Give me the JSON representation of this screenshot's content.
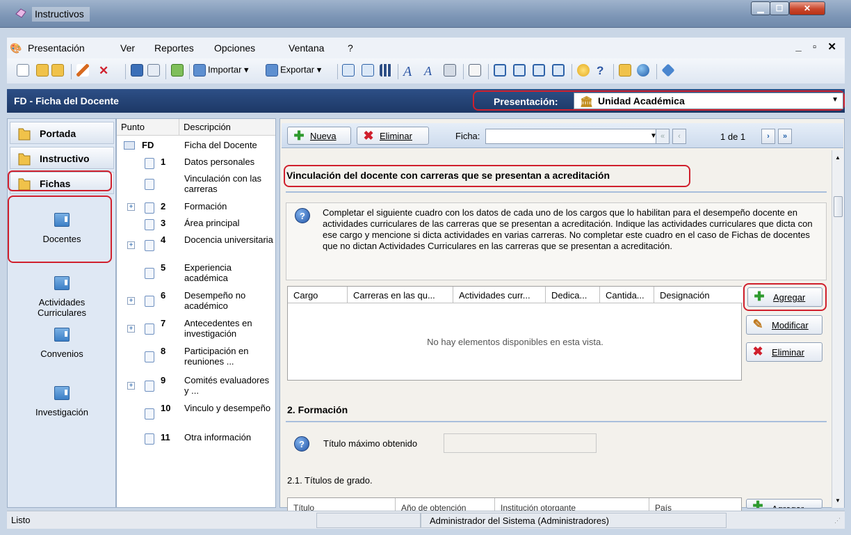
{
  "window": {
    "title": "Instructivos"
  },
  "menu": {
    "items": [
      {
        "label": "Presentación"
      },
      {
        "label": "Ver"
      },
      {
        "label": "Reportes"
      },
      {
        "label": "Opciones"
      },
      {
        "label": "Ventana"
      },
      {
        "label": "?"
      }
    ]
  },
  "toolbar": {
    "importar": "Importar",
    "exportar": "Exportar"
  },
  "header": {
    "title": "FD - Ficha del Docente",
    "presentacion_label": "Presentación:",
    "presentacion_value": "Unidad Académica"
  },
  "left_nav": {
    "sections": [
      "Portada",
      "Instructivo",
      "Fichas"
    ],
    "items": [
      "Docentes",
      "Actividades Curriculares",
      "Convenios",
      "Investigación"
    ]
  },
  "tree": {
    "columns": [
      "Punto",
      "Descripción"
    ],
    "rows": [
      {
        "num": "FD",
        "desc": "Ficha del Docente"
      },
      {
        "num": "1",
        "desc": "Datos personales"
      },
      {
        "num": "",
        "desc": "Vinculación con las carreras"
      },
      {
        "num": "2",
        "desc": "Formación"
      },
      {
        "num": "3",
        "desc": "Área principal"
      },
      {
        "num": "4",
        "desc": "Docencia universitaria"
      },
      {
        "num": "5",
        "desc": "Experiencia académica"
      },
      {
        "num": "6",
        "desc": "Desempeño no académico"
      },
      {
        "num": "7",
        "desc": "Antecedentes en investigación"
      },
      {
        "num": "8",
        "desc": "Participación en reuniones ..."
      },
      {
        "num": "9",
        "desc": "Comités evaluadores y ..."
      },
      {
        "num": "10",
        "desc": "Vinculo y desempeño"
      },
      {
        "num": "11",
        "desc": "Otra información"
      }
    ]
  },
  "main": {
    "nueva": "Nueva",
    "eliminar": "Eliminar",
    "ficha_label": "Ficha:",
    "record": "1 de 1",
    "section_title": "Vinculación del docente con carreras que se presentan a acreditación",
    "info": "Completar el siguiente cuadro con los datos de cada uno de los cargos que lo habilitan para el desempeño docente en actividades curriculares de las carreras que se presentan a acreditación. Indique las actividades curriculares que dicta con ese cargo y mencione si dicta actividades en varias carreras. No completar este cuadro en el caso de Fichas de docentes que no dictan Actividades Curriculares en las carreras que se presentan a acreditación.",
    "grid_columns": [
      "Cargo",
      "Carreras en las qu...",
      "Actividades curr...",
      "Dedica...",
      "Cantida...",
      "Designación"
    ],
    "grid_empty": "No hay elementos disponibles en esta vista.",
    "agregar": "Agregar",
    "modificar": "Modificar",
    "eliminar2": "Eliminar",
    "formacion_title": "2. Formación",
    "titulo_label": "Título máximo obtenido",
    "titulos_grado": "2.1. Títulos de grado.",
    "grid2_columns": [
      "Título",
      "Año de obtención",
      "Institución otorgante",
      "País"
    ]
  },
  "status": {
    "left": "Listo",
    "user": "Administrador del Sistema (Administradores)"
  }
}
